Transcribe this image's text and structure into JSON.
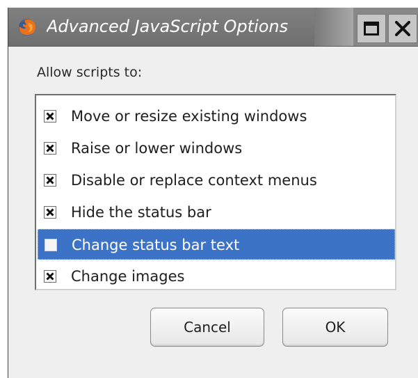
{
  "window": {
    "title": "Advanced JavaScript Options",
    "icon": "firefox-icon",
    "controls": [
      "maximize-icon",
      "close-icon"
    ]
  },
  "prompt": "Allow scripts to:",
  "options": [
    {
      "label": "Move or resize existing windows",
      "checked": true,
      "selected": false
    },
    {
      "label": "Raise or lower windows",
      "checked": true,
      "selected": false
    },
    {
      "label": "Disable or replace context menus",
      "checked": true,
      "selected": false
    },
    {
      "label": "Hide the status bar",
      "checked": true,
      "selected": false
    },
    {
      "label": "Change status bar text",
      "checked": false,
      "selected": true
    },
    {
      "label": "Change images",
      "checked": true,
      "selected": false
    }
  ],
  "buttons": {
    "cancel": "Cancel",
    "ok": "OK"
  },
  "colors": {
    "selection": "#3c73c6",
    "titlebar": "#7a7a7a",
    "dialog_bg": "#efefef"
  }
}
